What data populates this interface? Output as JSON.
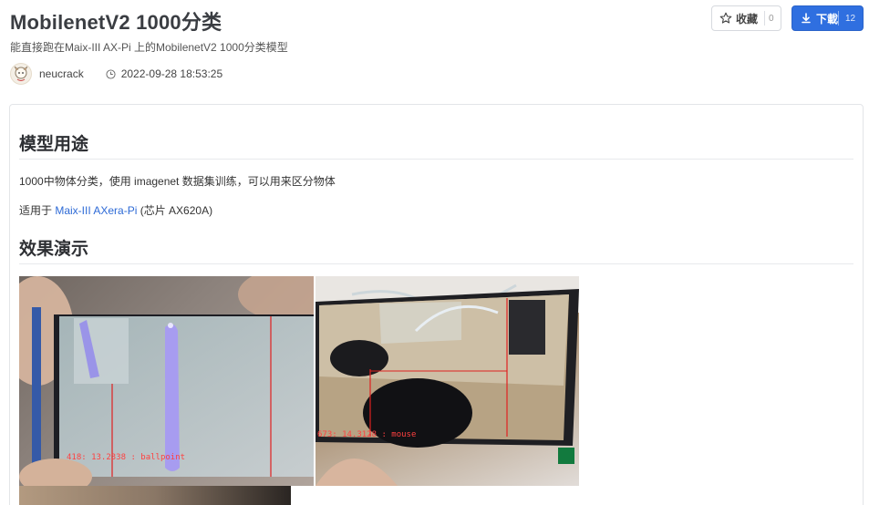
{
  "header": {
    "title": "MobilenetV2 1000分类",
    "subtitle": "能直接跑在Maix-III AX-Pi 上的MobilenetV2 1000分类模型",
    "author": "neucrack",
    "date": "2022-09-28 18:53:25"
  },
  "actions": {
    "favorite_label": "收藏",
    "favorite_count": "0",
    "download_label": "下載",
    "download_count": "12"
  },
  "content": {
    "section1_title": "模型用途",
    "section1_text": "1000中物体分类，使用 imagenet 数据集训练，可以用来区分物体",
    "applies_prefix": "适用于 ",
    "applies_link": "Maix-III AXera-Pi",
    "applies_suffix": " (芯片 AX620A)",
    "section2_title": "效果演示",
    "demo1_overlay": "418: 13.2338 : ballpoint",
    "demo2_overlay": "673: 14.3128 : mouse"
  },
  "icons": {
    "favorite": "star-icon",
    "download": "download-icon",
    "time": "clock-icon",
    "avatar": "user-avatar"
  },
  "colors": {
    "primary": "#2f6fe0",
    "link": "#2d6ad6",
    "title": "#3a3d42"
  }
}
